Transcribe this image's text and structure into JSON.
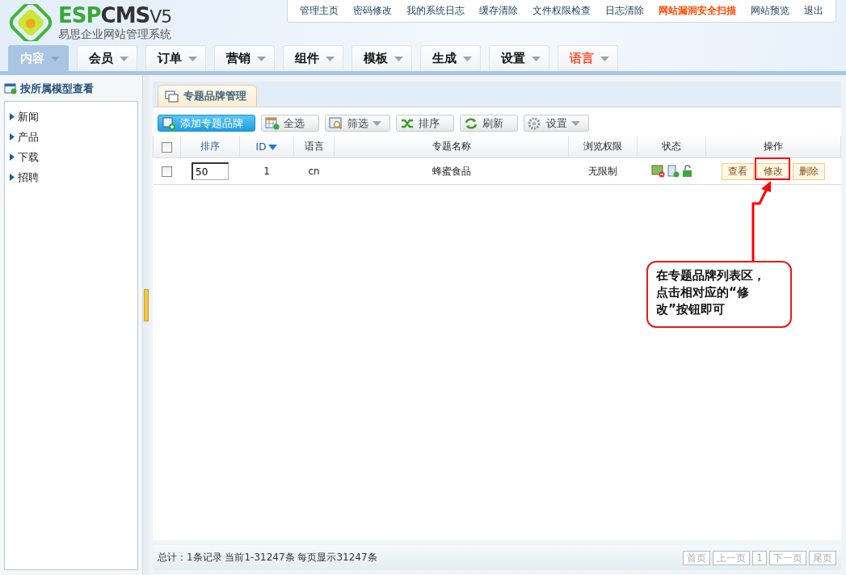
{
  "logo": {
    "brand_green": "ESP",
    "brand_dark": "CMS",
    "version": "V5",
    "subtitle": "易思企业网站管理系统"
  },
  "top_links": [
    {
      "label": "管理主页",
      "highlight": false
    },
    {
      "label": "密码修改",
      "highlight": false
    },
    {
      "label": "我的系统日志",
      "highlight": false
    },
    {
      "label": "缓存清除",
      "highlight": false
    },
    {
      "label": "文件权限检查",
      "highlight": false
    },
    {
      "label": "日志清除",
      "highlight": false
    },
    {
      "label": "网站漏洞安全扫描",
      "highlight": true
    },
    {
      "label": "网站预览",
      "highlight": false
    },
    {
      "label": "退出",
      "highlight": false
    }
  ],
  "nav_tabs": [
    {
      "label": "内容",
      "selected": true,
      "highlight": false
    },
    {
      "label": "会员",
      "selected": false,
      "highlight": false
    },
    {
      "label": "订单",
      "selected": false,
      "highlight": false
    },
    {
      "label": "营销",
      "selected": false,
      "highlight": false
    },
    {
      "label": "组件",
      "selected": false,
      "highlight": false
    },
    {
      "label": "模板",
      "selected": false,
      "highlight": false
    },
    {
      "label": "生成",
      "selected": false,
      "highlight": false
    },
    {
      "label": "设置",
      "selected": false,
      "highlight": false
    },
    {
      "label": "语言",
      "selected": false,
      "highlight": true
    }
  ],
  "sidebar": {
    "title": "按所属模型查看",
    "items": [
      "新闻",
      "产品",
      "下载",
      "招聘"
    ]
  },
  "panel_tab": "专题品牌管理",
  "toolbar": [
    {
      "label": "添加专题品牌",
      "kind": "primary",
      "dropdown": false
    },
    {
      "label": "全选",
      "kind": "normal",
      "dropdown": false
    },
    {
      "label": "筛选",
      "kind": "normal",
      "dropdown": true
    },
    {
      "label": "排序",
      "kind": "normal",
      "dropdown": false
    },
    {
      "label": "刷新",
      "kind": "normal",
      "dropdown": false
    },
    {
      "label": "设置",
      "kind": "normal",
      "dropdown": true
    }
  ],
  "table": {
    "select_all_checked": false,
    "columns": [
      {
        "label": "排序",
        "sorted": false
      },
      {
        "label": "ID",
        "sorted": true
      },
      {
        "label": "语言",
        "sorted": false
      },
      {
        "label": "专题名称",
        "sorted": false
      },
      {
        "label": "浏览权限",
        "sorted": false
      },
      {
        "label": "状态",
        "sorted": false
      },
      {
        "label": "操作",
        "sorted": false
      }
    ],
    "rows": [
      {
        "checked": false,
        "order": "50",
        "id": "1",
        "language": "cn",
        "name": "蜂蜜食品",
        "access": "无限制",
        "actions": [
          {
            "label": "查看",
            "highlighted": false
          },
          {
            "label": "修改",
            "highlighted": true
          },
          {
            "label": "删除",
            "highlighted": false
          }
        ]
      }
    ]
  },
  "annotation": {
    "text": "在专题品牌列表区，点击相对应的“修改”按钮即可"
  },
  "footer": {
    "summary": "总计：1条记录 当前1-31247条 每页显示31247条",
    "pager": [
      "首页",
      "上一页",
      "1",
      "下一页",
      "尾页"
    ]
  }
}
